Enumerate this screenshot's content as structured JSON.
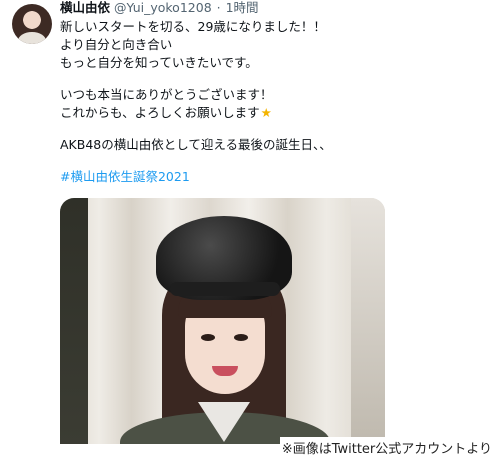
{
  "tweet": {
    "author_name": "横山由依",
    "handle": "@Yui_yoko1208",
    "separator": "·",
    "time": "1時間",
    "lines": [
      "新しいスタートを切る、29歳になりました！！",
      "より自分と向き合い",
      "もっと自分を知っていきたいです。",
      "いつも本当にありがとうございます！",
      "これからも、よろしくお願いします",
      "AKB48の横山由依として迎える最後の誕生日、、"
    ],
    "hashtag": "#横山由依生誕祭2021"
  },
  "icons": {
    "star": "star-emoji-icon",
    "avatar": "profile-avatar"
  },
  "credit": "※画像はTwitter公式アカウントより",
  "colors": {
    "link": "#1d9bf0",
    "muted": "#536471",
    "text": "#0f1419"
  }
}
